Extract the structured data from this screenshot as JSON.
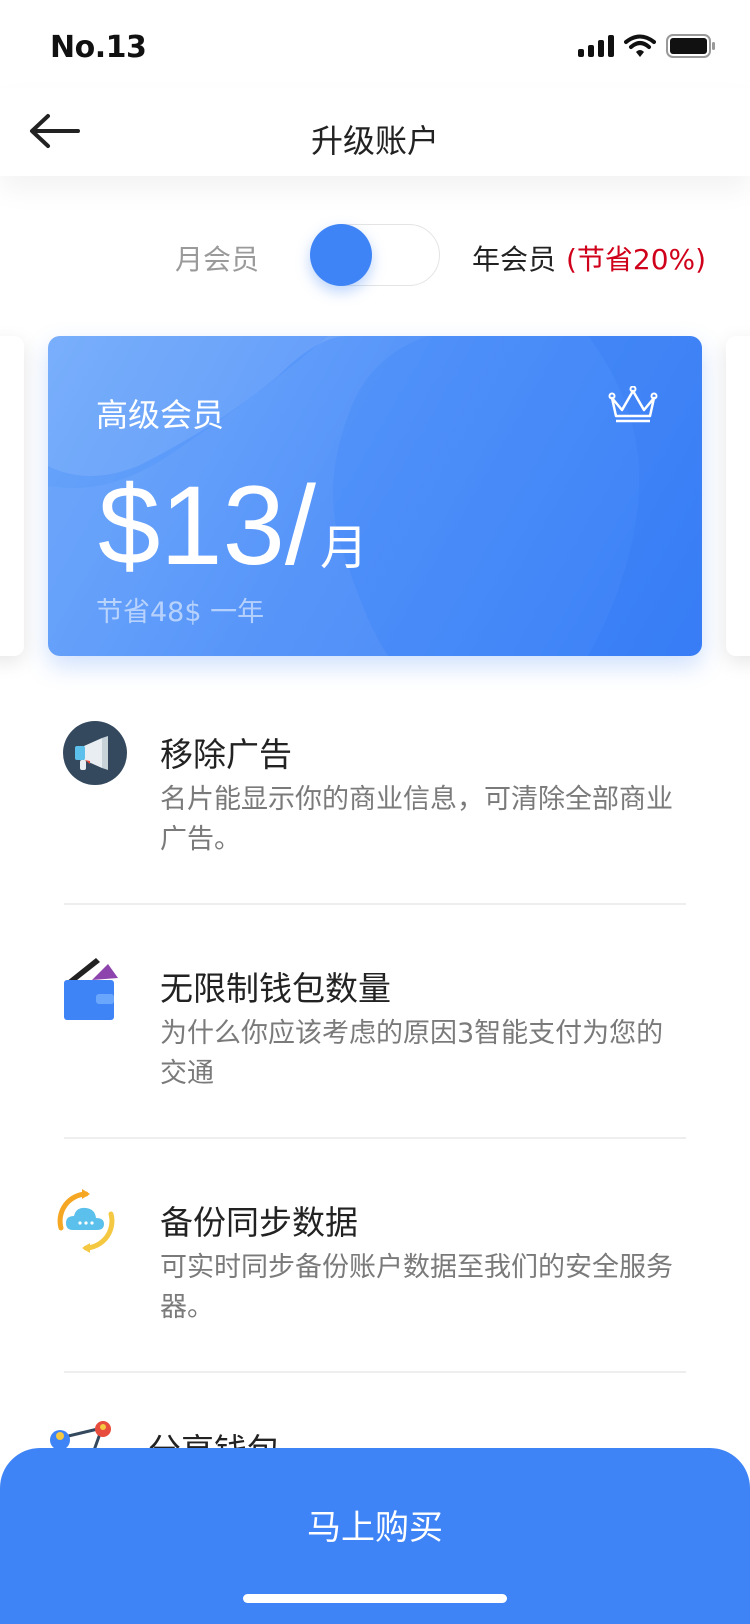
{
  "status_bar": {
    "carrier": "No.13"
  },
  "nav": {
    "title": "升级账户"
  },
  "plan_toggle": {
    "monthly_label": "月会员",
    "yearly_label": "年会员",
    "yearly_savings": "(节省20%)",
    "selected": "monthly"
  },
  "plan_card": {
    "title": "高级会员",
    "price": "$13/",
    "unit": "月",
    "note": "节省48$ 一年"
  },
  "features": [
    {
      "icon": "megaphone-icon",
      "title": "移除广告",
      "desc": "名片能显示你的商业信息，可清除全部商业广告。"
    },
    {
      "icon": "wallet-icon",
      "title": "无限制钱包数量",
      "desc": "为什么你应该考虑的原因3智能支付为您的交通"
    },
    {
      "icon": "cloud-sync-icon",
      "title": "备份同步数据",
      "desc": "可实时同步备份账户数据至我们的安全服务器。"
    },
    {
      "icon": "share-icon",
      "title": "分享钱包",
      "desc": ""
    }
  ],
  "buy_button": {
    "label": "马上购买"
  },
  "colors": {
    "accent": "#3f84f6",
    "savings": "#d0021b",
    "text": "#222222",
    "muted": "#7a7a7a"
  }
}
